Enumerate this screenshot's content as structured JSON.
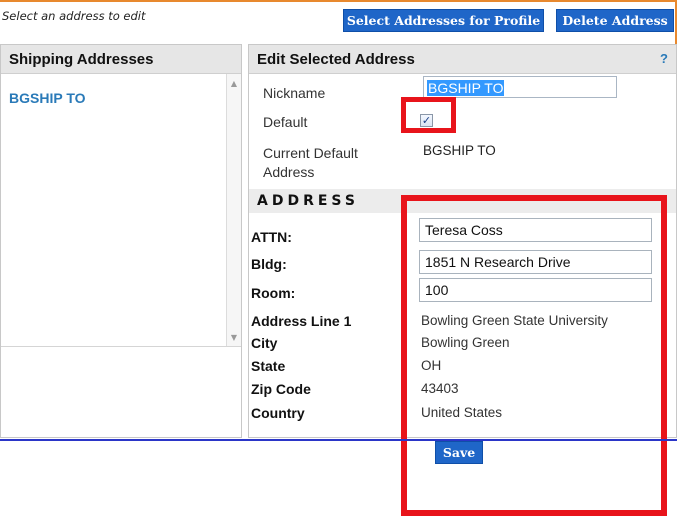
{
  "header": {
    "hint": "Select an address to edit",
    "select_button": "Select Addresses for Profile",
    "delete_button": "Delete Address"
  },
  "left_panel": {
    "title": "Shipping Addresses",
    "items": [
      {
        "label": "BGSHIP TO"
      }
    ]
  },
  "edit_panel": {
    "title": "Edit Selected Address",
    "help": "?",
    "nickname_label": "Nickname",
    "nickname_value": "BGSHIP TO",
    "default_label": "Default",
    "default_checked": true,
    "checkbox_glyph": "✓",
    "current_default_label_line1": "Current Default",
    "current_default_label_line2": "Address",
    "current_default_value": "BGSHIP TO"
  },
  "address": {
    "section_title": "ADDRESS",
    "attn_label": "ATTN:",
    "attn_value": "Teresa Coss",
    "bldg_label": "Bldg:",
    "bldg_value": "1851 N Research Drive",
    "room_label": "Room:",
    "room_value": "100",
    "line1_label": "Address Line 1",
    "line1_value": "Bowling Green State University",
    "city_label": "City",
    "city_value": "Bowling Green",
    "state_label": "State",
    "state_value": "OH",
    "zip_label": "Zip Code",
    "zip_value": "43403",
    "country_label": "Country",
    "country_value": "United States",
    "save_button": "Save"
  },
  "colors": {
    "button_blue": "#1f66c8",
    "highlight_red": "#e8141b",
    "link_blue": "#2a7ab8"
  }
}
